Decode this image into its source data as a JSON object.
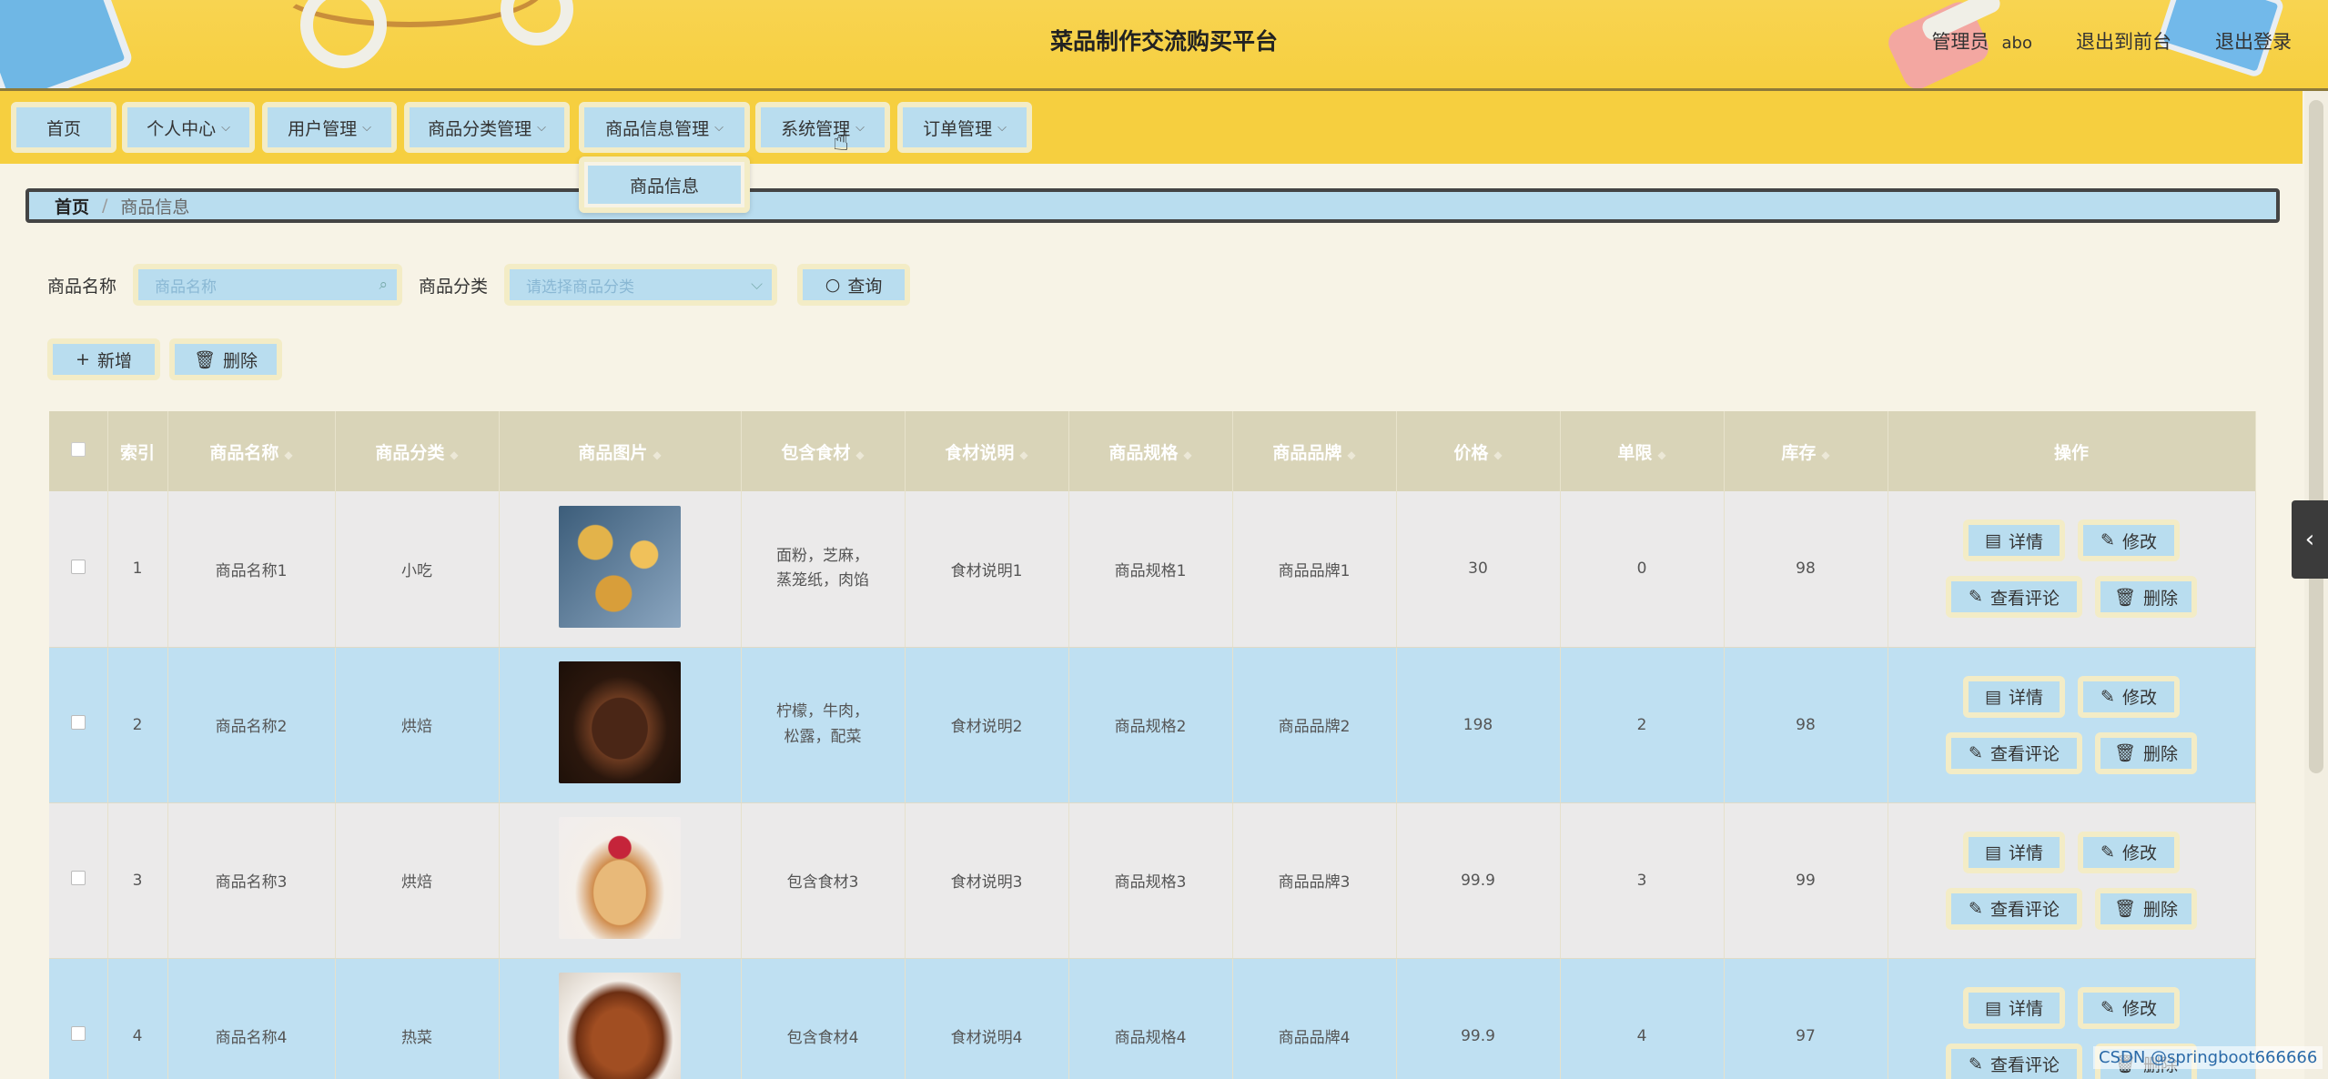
{
  "header": {
    "title": "菜品制作交流购买平台",
    "role": "管理员",
    "username": "abo",
    "to_front": "退出到前台",
    "logout": "退出登录"
  },
  "nav": {
    "items": [
      {
        "label": "首页",
        "has_dropdown": false
      },
      {
        "label": "个人中心",
        "has_dropdown": true
      },
      {
        "label": "用户管理",
        "has_dropdown": true
      },
      {
        "label": "商品分类管理",
        "has_dropdown": true
      },
      {
        "label": "商品信息管理",
        "has_dropdown": true
      },
      {
        "label": "系统管理",
        "has_dropdown": true
      },
      {
        "label": "订单管理",
        "has_dropdown": true
      }
    ],
    "dropdown_item": "商品信息"
  },
  "breadcrumb": {
    "home": "首页",
    "sep": "/",
    "current": "商品信息"
  },
  "search": {
    "name_label": "商品名称",
    "name_placeholder": "商品名称",
    "category_label": "商品分类",
    "category_placeholder": "请选择商品分类",
    "query_button": "查询"
  },
  "actions": {
    "add": "新增",
    "delete": "删除"
  },
  "table": {
    "headers": {
      "index": "索引",
      "name": "商品名称",
      "category": "商品分类",
      "image": "商品图片",
      "ingredients": "包含食材",
      "ingredient_desc": "食材说明",
      "spec": "商品规格",
      "brand": "商品品牌",
      "price": "价格",
      "limit": "单限",
      "stock": "库存",
      "ops": "操作"
    },
    "rows": [
      {
        "index": "1",
        "name": "商品名称1",
        "category": "小吃",
        "image": "food-image-1",
        "ingredients": "面粉，芝麻，蒸笼纸，肉馅",
        "ingredient_desc": "食材说明1",
        "spec": "商品规格1",
        "brand": "商品品牌1",
        "price": "30",
        "limit": "0",
        "stock": "98"
      },
      {
        "index": "2",
        "name": "商品名称2",
        "category": "烘焙",
        "image": "food-image-2",
        "ingredients": "柠檬，牛肉，松露，配菜",
        "ingredient_desc": "食材说明2",
        "spec": "商品规格2",
        "brand": "商品品牌2",
        "price": "198",
        "limit": "2",
        "stock": "98"
      },
      {
        "index": "3",
        "name": "商品名称3",
        "category": "烘焙",
        "image": "food-image-3",
        "ingredients": "包含食材3",
        "ingredient_desc": "食材说明3",
        "spec": "商品规格3",
        "brand": "商品品牌3",
        "price": "99.9",
        "limit": "3",
        "stock": "99"
      },
      {
        "index": "4",
        "name": "商品名称4",
        "category": "热菜",
        "image": "food-image-4",
        "ingredients": "包含食材4",
        "ingredient_desc": "食材说明4",
        "spec": "商品规格4",
        "brand": "商品品牌4",
        "price": "99.9",
        "limit": "4",
        "stock": "97"
      }
    ],
    "op_labels": {
      "detail": "详情",
      "edit": "修改",
      "comments": "查看评论",
      "delete": "删除"
    }
  },
  "watermark": "CSDN @springboot666666",
  "colors": {
    "header": "#f6cf3f",
    "button": "#b9ddef",
    "row_alt": "#bfe0f2",
    "table_head": "#d9d4b8"
  }
}
